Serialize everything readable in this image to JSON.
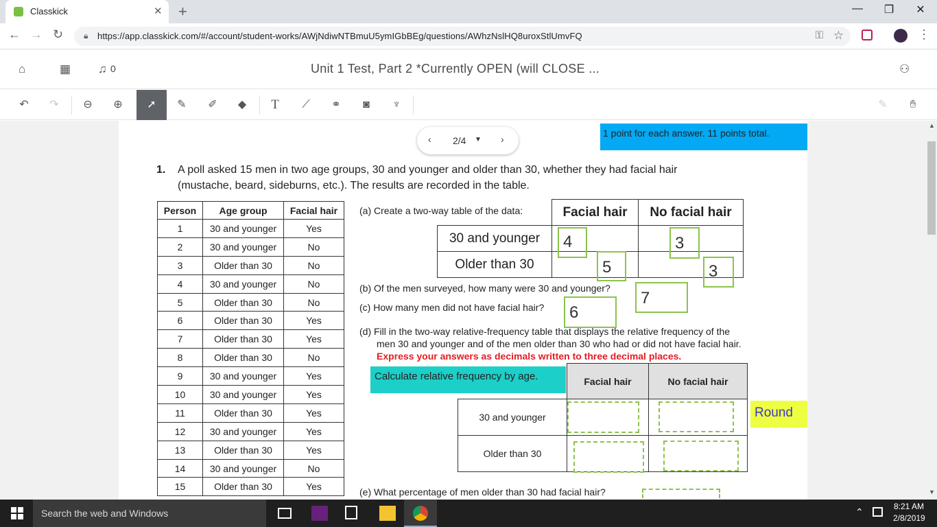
{
  "browser": {
    "tab_title": "Classkick",
    "tab_close": "✕",
    "new_tab": "+",
    "url": "https://app.classkick.com/#/account/student-works/AWjNdiwNTBmuU5ymIGbBEg/questions/AWhzNslHQ8uroxStlUmvFQ",
    "window_controls": {
      "minimize": "—",
      "maximize": "❐",
      "close": "✕"
    }
  },
  "app": {
    "notification_count": "0",
    "title": "Unit 1 Test, Part 2 *Currently OPEN (will CLOSE ..."
  },
  "pager": {
    "label": "2/4",
    "prev": "‹",
    "next": "›",
    "caret": "▼"
  },
  "banners": {
    "points": "1 point for each answer.  11 points total.",
    "calculate": "Calculate relative frequency by age.",
    "round": "Round"
  },
  "question": {
    "number": "1.",
    "text_line1": "A poll asked 15 men in two age groups, 30 and younger and older than 30, whether they had facial hair",
    "text_line2": "(mustache, beard, sideburns, etc.). The results are recorded in the table.",
    "part_a": "(a)  Create a two-way table of the data:",
    "part_b": "(b)  Of the men surveyed, how many were 30 and younger?",
    "part_c": "(c)  How many men did not have facial hair?",
    "part_d_line1": "(d)  Fill in the two-way relative-frequency table that displays the relative frequency of the",
    "part_d_line2": "men 30 and younger and of the men older than 30 who had or did not have facial hair.",
    "part_d_express": "Express your answers as decimals written to three decimal places.",
    "part_e": "(e)  What percentage of men older than 30 had facial hair?"
  },
  "data_table": {
    "headers": [
      "Person",
      "Age group",
      "Facial hair"
    ],
    "rows": [
      [
        "1",
        "30 and younger",
        "Yes"
      ],
      [
        "2",
        "30 and younger",
        "No"
      ],
      [
        "3",
        "Older than 30",
        "No"
      ],
      [
        "4",
        "30 and younger",
        "No"
      ],
      [
        "5",
        "Older than 30",
        "No"
      ],
      [
        "6",
        "Older than 30",
        "Yes"
      ],
      [
        "7",
        "Older than 30",
        "Yes"
      ],
      [
        "8",
        "Older than 30",
        "No"
      ],
      [
        "9",
        "30 and younger",
        "Yes"
      ],
      [
        "10",
        "30 and younger",
        "Yes"
      ],
      [
        "11",
        "Older than 30",
        "Yes"
      ],
      [
        "12",
        "30 and younger",
        "Yes"
      ],
      [
        "13",
        "Older than 30",
        "Yes"
      ],
      [
        "14",
        "30 and younger",
        "No"
      ],
      [
        "15",
        "Older than 30",
        "Yes"
      ]
    ]
  },
  "two_way_table": {
    "headers": [
      "Facial hair",
      "No facial hair"
    ],
    "rows": [
      "30 and younger",
      "Older than 30"
    ]
  },
  "answers": {
    "a_young_facial": "4",
    "a_young_nofacial": "3",
    "a_old_facial": "5",
    "a_old_nofacial": "3",
    "b": "7",
    "c": "6"
  },
  "rf_table": {
    "headers": [
      "Facial hair",
      "No facial hair"
    ],
    "rows": [
      "30 and younger",
      "Older than 30"
    ]
  },
  "taskbar": {
    "search_placeholder": "Search the web and Windows",
    "time": "8:21 AM",
    "date": "2/8/2019"
  },
  "colors": {
    "points_banner": "#03a9f4",
    "calculate_banner": "#1ccfc9",
    "round_banner": "#eeff41",
    "answer_box": "#8bc34a",
    "express_text": "#e51c23"
  }
}
